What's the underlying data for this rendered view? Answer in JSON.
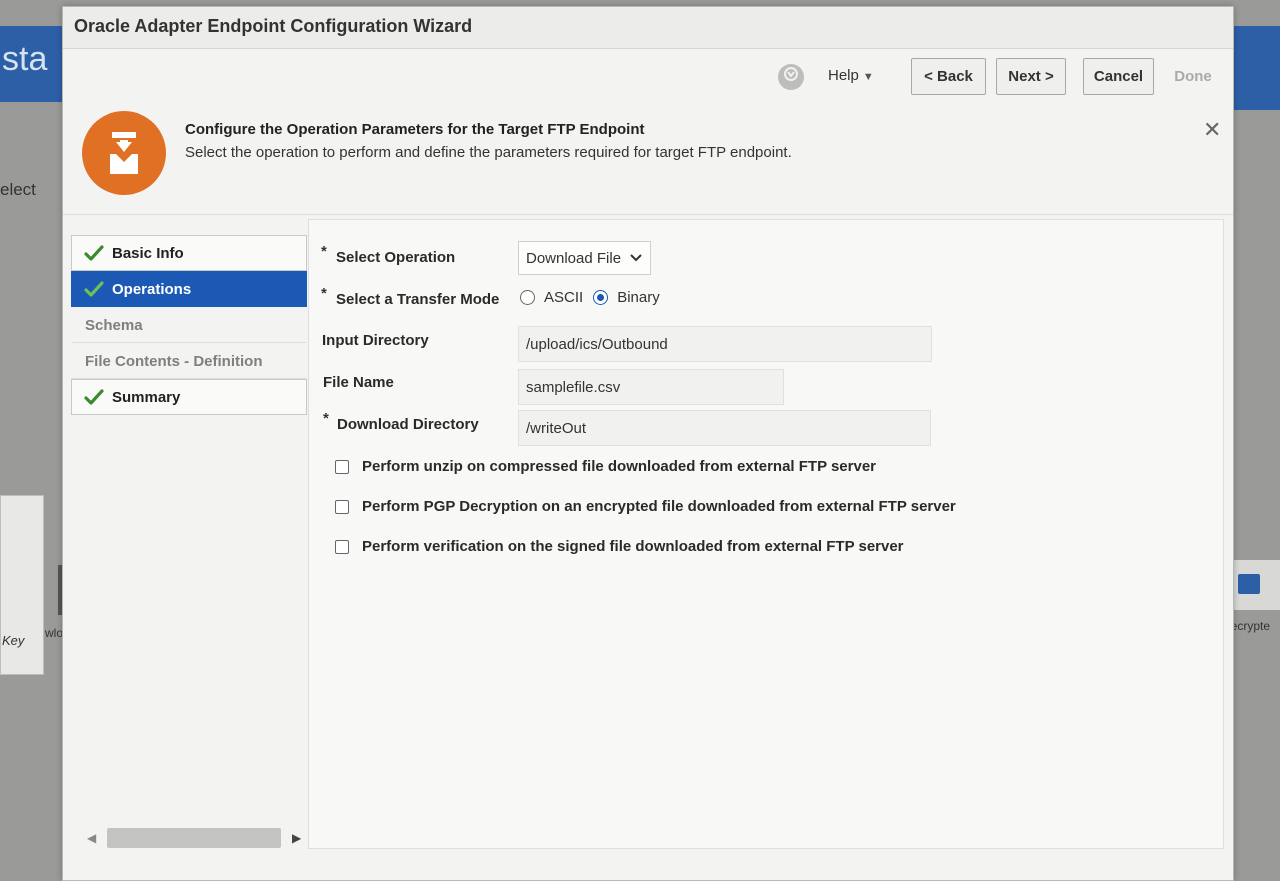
{
  "background": {
    "left_heading_fragment": "sta",
    "left_text_fragment": "elect",
    "card_label": "Key",
    "card_label2": "wlo",
    "right_card_label": "Decrypte"
  },
  "dialog": {
    "title": "Oracle Adapter Endpoint Configuration Wizard",
    "toolbar": {
      "help_label": "Help",
      "back_label": "< Back",
      "next_label": "Next >",
      "cancel_label": "Cancel",
      "done_label": "Done"
    },
    "header": {
      "icon": "ftp-adapter-icon",
      "title": "Configure the Operation Parameters for the Target FTP Endpoint",
      "subtitle": "Select the operation to perform and define the parameters required for target FTP endpoint.",
      "close_icon": "close-icon"
    },
    "nav": [
      {
        "label": "Basic Info",
        "state": "done"
      },
      {
        "label": "Operations",
        "state": "active"
      },
      {
        "label": "Schema",
        "state": "disabled"
      },
      {
        "label": "File Contents - Definition",
        "state": "disabled"
      },
      {
        "label": "Summary",
        "state": "done"
      }
    ],
    "form": {
      "select_operation": {
        "label": "Select Operation",
        "required": "*",
        "value": "Download File"
      },
      "transfer_mode": {
        "label": "Select a Transfer Mode",
        "required": "*",
        "options": [
          "ASCII",
          "Binary"
        ],
        "selected": "Binary"
      },
      "input_directory": {
        "label": "Input Directory",
        "value": "/upload/ics/Outbound"
      },
      "file_name": {
        "label": "File Name",
        "value": "samplefile.csv"
      },
      "download_directory": {
        "label": "Download Directory",
        "required": "*",
        "value": "/writeOut"
      },
      "checkboxes": [
        {
          "label": "Perform unzip on compressed file downloaded from external FTP server",
          "checked": false
        },
        {
          "label": "Perform PGP Decryption on an encrypted file downloaded from external FTP server",
          "checked": false
        },
        {
          "label": "Perform verification on the signed file downloaded from external FTP server",
          "checked": false
        }
      ]
    },
    "colors": {
      "accent": "#1b59b5",
      "header_icon": "#e07024",
      "check": "#3a8a2e"
    }
  }
}
